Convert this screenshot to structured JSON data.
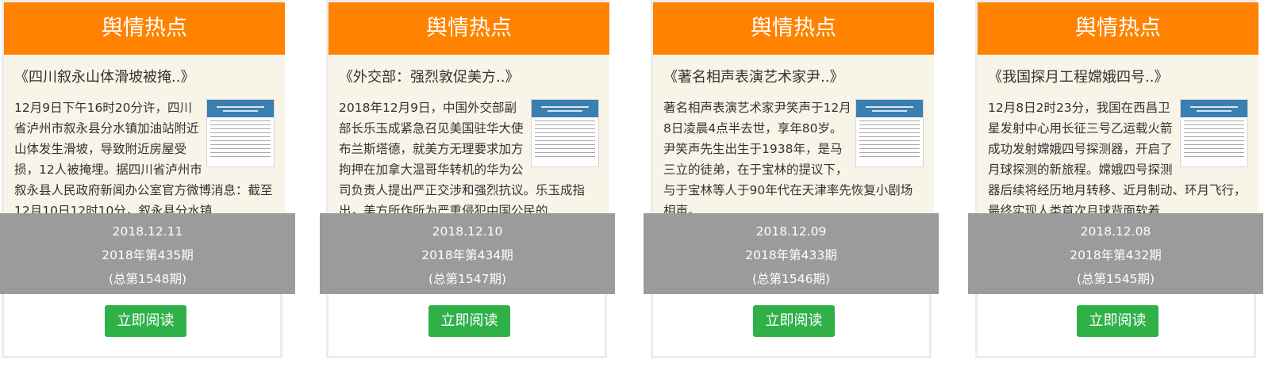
{
  "cards": [
    {
      "header": "舆情热点",
      "title": "《四川叙永山体滑坡被掩..》",
      "summary": "12月9日下午16时20分许，四川省泸州市叙永县分水镇加油站附近山体发生滑坡，导致附近房屋受损，12人被掩埋。据四川省泸州市叙永县人民政府新闻办公室官方微博消息：截至12月10日12时10分，叙永县分水镇",
      "date": "2018.12.11",
      "issue": "2018年第435期",
      "total": "(总第1548期)",
      "button": "立即阅读"
    },
    {
      "header": "舆情热点",
      "title": "《外交部：强烈敦促美方..》",
      "summary": "2018年12月9日，中国外交部副部长乐玉成紧急召见美国驻华大使布兰斯塔德，就美方无理要求加方拘押在加拿大温哥华转机的华为公司负责人提出严正交涉和强烈抗议。乐玉成指出，美方所作所为严重侵犯中国公民的",
      "date": "2018.12.10",
      "issue": "2018年第434期",
      "total": "(总第1547期)",
      "button": "立即阅读"
    },
    {
      "header": "舆情热点",
      "title": "《著名相声表演艺术家尹..》",
      "summary": "著名相声表演艺术家尹笑声于12月8日凌晨4点半去世，享年80岁。尹笑声先生出生于1938年，是马三立的徒弟，在于宝林的提议下，与于宝林等人于90年代在天津率先恢复小剧场相声。",
      "date": "2018.12.09",
      "issue": "2018年第433期",
      "total": "(总第1546期)",
      "button": "立即阅读"
    },
    {
      "header": "舆情热点",
      "title": "《我国探月工程嫦娥四号..》",
      "summary": "12月8日2时23分，我国在西昌卫星发射中心用长征三号乙运载火箭成功发射嫦娥四号探测器，开启了月球探测的新旅程。嫦娥四号探测器后续将经历地月转移、近月制动、环月飞行，最终实现人类首次月球背面软着",
      "date": "2018.12.08",
      "issue": "2018年第432期",
      "total": "(总第1545期)",
      "button": "立即阅读"
    }
  ],
  "colors": {
    "header_bg": "#ff8200",
    "body_bg": "#f8f4e8",
    "overlay_bg": "#9b9b9b",
    "button_bg": "#2fb148"
  },
  "icons": {
    "thumbnail": "report-thumbnail"
  }
}
